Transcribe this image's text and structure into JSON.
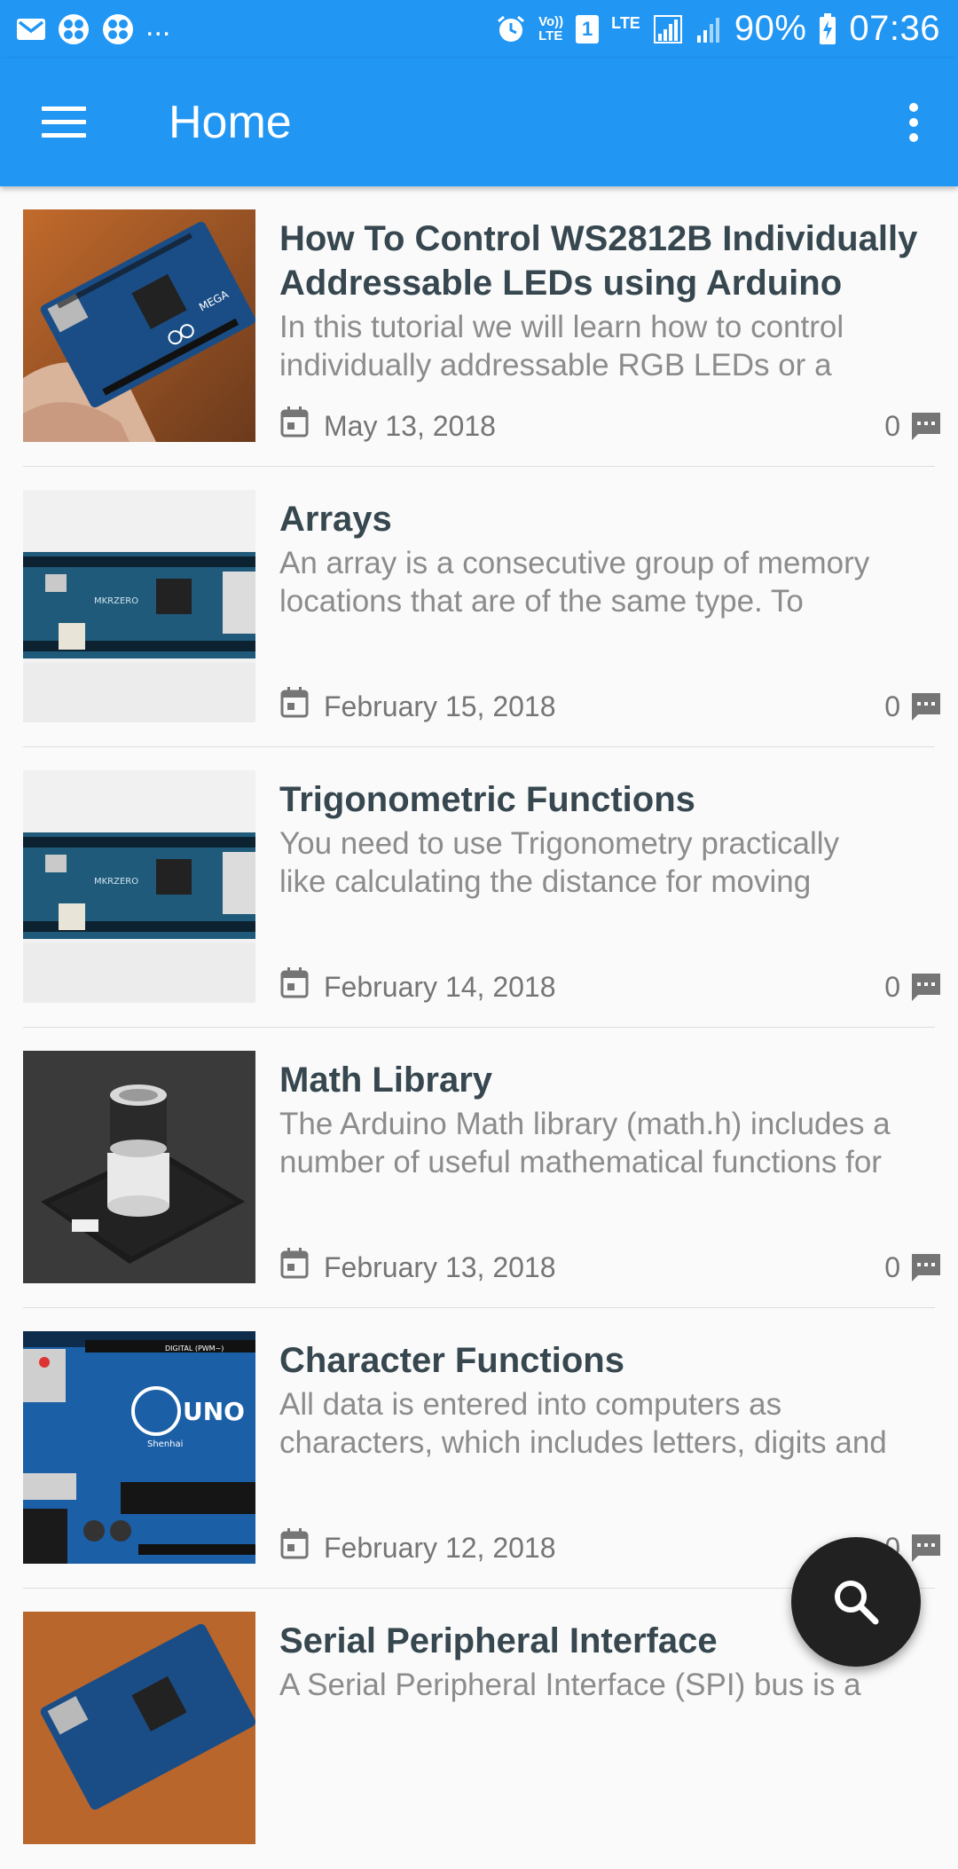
{
  "status_bar": {
    "overflow_indicator": "...",
    "signal_label_top": "Vo))",
    "signal_label_bottom": "LTE",
    "sim_slot": "1",
    "network_type": "LTE",
    "battery_percent": "90%",
    "time": "07:36"
  },
  "app_bar": {
    "title": "Home",
    "menu_icon": "menu-icon",
    "overflow_icon": "more-vert-icon"
  },
  "posts": [
    {
      "title": "How To Control WS2812B Individually Addressable LEDs using Arduino",
      "excerpt_lines": [
        "In this tutorial we will learn how to control",
        "individually addressable RGB LEDs or a"
      ],
      "date": "May 13, 2018",
      "comments": "0",
      "thumbnail": "arduino-mega-in-hand"
    },
    {
      "title": "Arrays",
      "excerpt_lines": [
        "An array is a consecutive group of memory",
        "locations that are of the same type. To"
      ],
      "date": "February 15, 2018",
      "comments": "0",
      "thumbnail": "arduino-mkrzero-board"
    },
    {
      "title": "Trigonometric Functions",
      "excerpt_lines": [
        "You need to use Trigonometry practically",
        "like calculating the distance for moving"
      ],
      "date": "February 14, 2018",
      "comments": "0",
      "thumbnail": "arduino-mkrzero-board"
    },
    {
      "title": "Math Library",
      "excerpt_lines": [
        "The Arduino Math library (math.h) includes a",
        "number of useful mathematical functions for"
      ],
      "date": "February 13, 2018",
      "comments": "0",
      "thumbnail": "gas-sensor-module"
    },
    {
      "title": "Character Functions",
      "excerpt_lines": [
        "All data is entered into computers as",
        "characters, which includes letters, digits and"
      ],
      "date": "February 12, 2018",
      "comments": "0",
      "thumbnail": "arduino-uno-board"
    },
    {
      "title": "Serial Peripheral Interface",
      "excerpt_lines": [
        "A Serial Peripheral Interface (SPI) bus is a"
      ],
      "date": "",
      "comments": "",
      "thumbnail": "arduino-mega-in-hand"
    }
  ],
  "thumbnail_labels": {
    "mega": "MEGA",
    "mkrzero": "MKRZERO",
    "uno": "UNO",
    "uno_maker": "Shenhai",
    "uno_digital": "DIGITAL (PWM~)"
  },
  "fab": {
    "icon": "search-icon"
  },
  "colors": {
    "primary": "#2196f3",
    "title_text": "#37474f",
    "excerpt_text": "#8c8c8c",
    "fab": "#212121"
  }
}
